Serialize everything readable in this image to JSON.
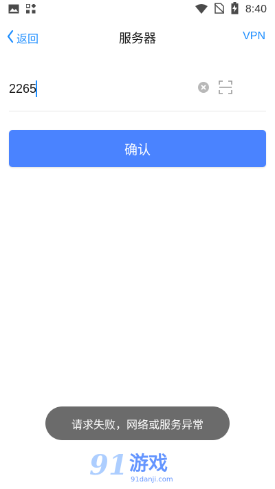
{
  "status_bar": {
    "time": "8:40",
    "icons": [
      "image-icon",
      "apps-grid-icon",
      "wifi-icon",
      "no-sim-icon",
      "battery-charging-icon"
    ]
  },
  "nav": {
    "back_label": "返回",
    "title": "服务器",
    "right_action": "VPN"
  },
  "form": {
    "server_value": "2265",
    "clear_icon": "clear-icon",
    "scan_icon": "scan-icon"
  },
  "confirm_label": "确认",
  "toast_message": "请求失败，网络或服务异常",
  "watermark": {
    "mark": "91",
    "text": "游戏",
    "url": "91danji.com"
  },
  "colors": {
    "accent": "#1a8cff",
    "button": "#4a83ff",
    "toast_bg": "#6b6b6b"
  }
}
